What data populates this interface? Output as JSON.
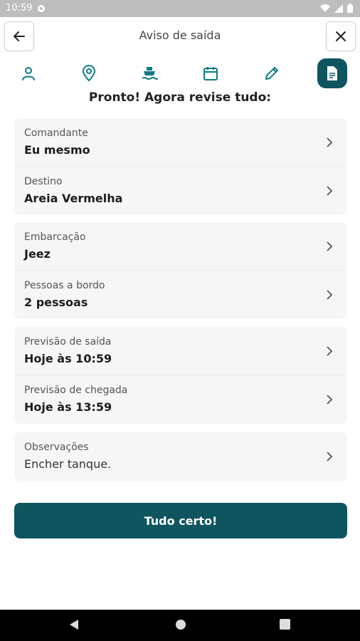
{
  "status_bar": {
    "time": "10:59"
  },
  "header": {
    "title": "Aviso de saída"
  },
  "steps": [
    {
      "icon": "person-icon"
    },
    {
      "icon": "location-pin-icon"
    },
    {
      "icon": "boat-icon"
    },
    {
      "icon": "calendar-icon"
    },
    {
      "icon": "pencil-icon"
    },
    {
      "icon": "document-icon",
      "active": true
    }
  ],
  "review": {
    "title": "Pronto! Agora revise tudo:"
  },
  "cards": [
    {
      "rows": [
        {
          "label": "Comandante",
          "value": "Eu mesmo"
        },
        {
          "label": "Destino",
          "value": "Areia Vermelha"
        }
      ]
    },
    {
      "rows": [
        {
          "label": "Embarcação",
          "value": "Jeez"
        },
        {
          "label": "Pessoas a bordo",
          "value": "2 pessoas"
        }
      ]
    },
    {
      "rows": [
        {
          "label": "Previsão de saída",
          "value": "Hoje às 10:59"
        },
        {
          "label": "Previsão de chegada",
          "value": "Hoje às 13:59"
        }
      ]
    },
    {
      "rows": [
        {
          "label": "Observações",
          "value": "Encher tanque."
        }
      ]
    }
  ],
  "confirm": {
    "label": "Tudo certo!"
  },
  "colors": {
    "primary": "#0e5560",
    "card_bg": "#f6f6f6"
  }
}
